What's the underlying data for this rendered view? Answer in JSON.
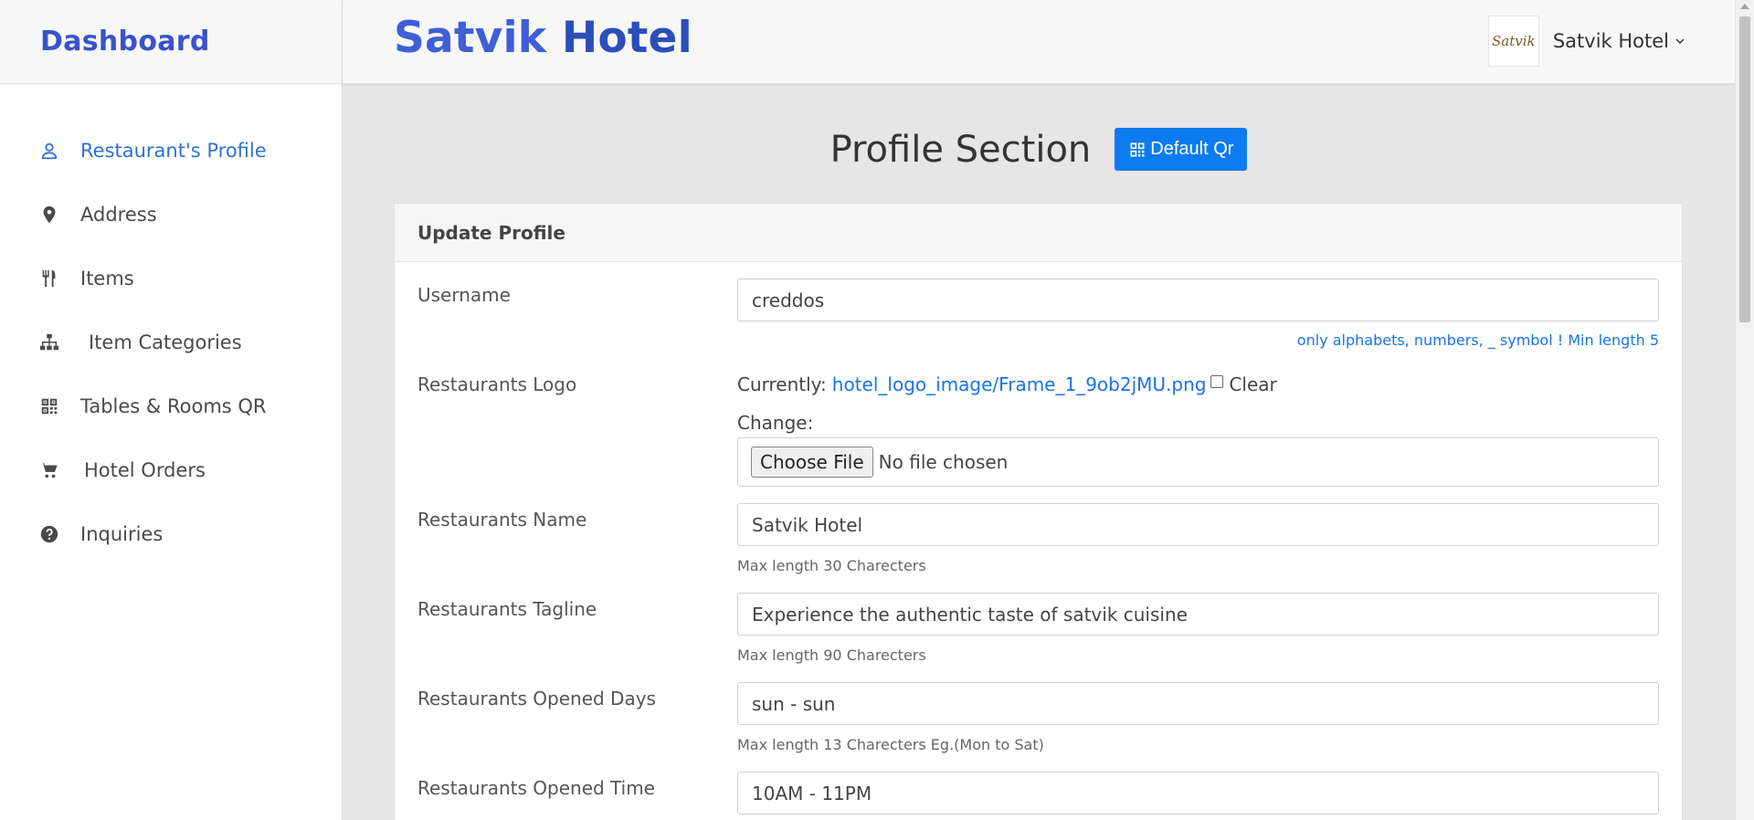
{
  "sidebar": {
    "brand": "Dashboard",
    "items": [
      {
        "label": "Restaurant's Profile",
        "icon": "user-icon",
        "active": true
      },
      {
        "label": "Address",
        "icon": "map-pin-icon"
      },
      {
        "label": "Items",
        "icon": "utensils-icon"
      },
      {
        "label": "Item Categories",
        "icon": "sitemap-icon"
      },
      {
        "label": "Tables & Rooms QR",
        "icon": "qr-code-icon"
      },
      {
        "label": "Hotel Orders",
        "icon": "cart-icon"
      },
      {
        "label": "Inquiries",
        "icon": "question-circle-icon"
      }
    ]
  },
  "header": {
    "title_first": "Satvik",
    "title_second": "Hotel",
    "avatar_text": "Satvik",
    "user_name": "Satvik Hotel"
  },
  "page": {
    "title": "Profile Section",
    "qr_button": "Default Qr"
  },
  "form": {
    "header": "Update Profile",
    "username": {
      "label": "Username",
      "value": "creddos",
      "help": "only alphabets, numbers, _ symbol ! Min length 5"
    },
    "logo": {
      "label": "Restaurants Logo",
      "currently": "Currently:",
      "file_link": "hotel_logo_image/Frame_1_9ob2jMU.png",
      "clear": "Clear",
      "change": "Change:",
      "choose_button": "Choose File",
      "no_file": "No file chosen"
    },
    "name": {
      "label": "Restaurants Name",
      "value": "Satvik Hotel",
      "help": "Max length 30 Charecters"
    },
    "tagline": {
      "label": "Restaurants Tagline",
      "value": "Experience the authentic taste of satvik cuisine",
      "help": "Max length 90 Charecters"
    },
    "opened_days": {
      "label": "Restaurants Opened Days",
      "value": "sun - sun",
      "help": "Max length 13 Charecters Eg.(Mon to Sat)"
    },
    "opened_time": {
      "label": "Restaurants Opened Time",
      "value": "10AM - 11PM"
    }
  },
  "colors": {
    "brand_blue": "#3a52c9",
    "accent_blue": "#0d7bf0",
    "link_blue": "#1a73e8"
  }
}
